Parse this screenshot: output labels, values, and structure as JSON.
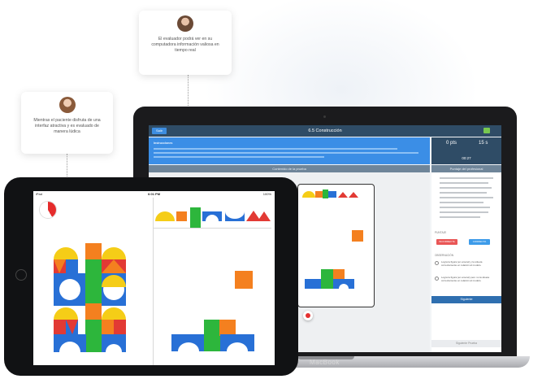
{
  "callouts": {
    "evaluator": "El evaluador podrá ver en su computadora información valiosa en tiempo real",
    "patient": "Mientras el paciente disfruta de una interfaz atractiva y es evaluado de manera lúdica"
  },
  "laptop": {
    "brand": "MacBook",
    "app": {
      "back_button": "Salir",
      "title": "6.5 Construcción",
      "instructions_title": "Instrucciones",
      "timer": {
        "minutes": "0 pts",
        "seconds": "15 s",
        "clock": "00:27"
      },
      "band_left": "Contenido de la prueba",
      "band_right": "Puntaje del profesional",
      "side": {
        "section_a": "PUNTAJE",
        "button_incorrect": "INCORRECTA",
        "button_correct": "CORRECTA",
        "section_b": "OBSERVACIÓN",
        "option_1": "Logra la figura (en amorel) y la silueta correctamente en relación al modelo.",
        "option_2": "Logra la figura (en amorel) pero no la silueta correctamente en relación al modelo.",
        "next_button": "Siguiente",
        "footer": "Siguiente Prueba"
      }
    }
  },
  "tablet": {
    "status_left": "iPad",
    "status_time": "6:01 PM",
    "status_right": "100%"
  },
  "colors": {
    "yellow": "#f5cd17",
    "orange": "#f4801f",
    "red": "#e23a34",
    "blue": "#2870d6",
    "green": "#2db63c",
    "accent": "#3b8ee6"
  }
}
